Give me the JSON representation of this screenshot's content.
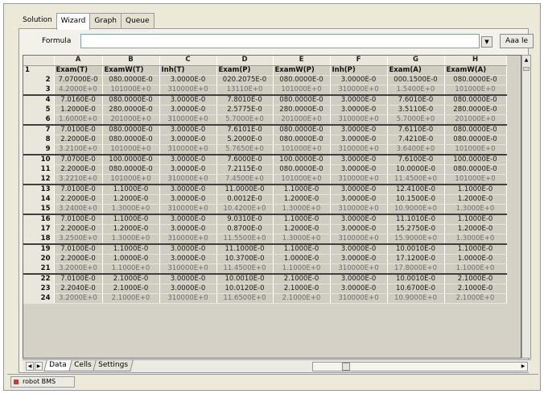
{
  "tabs": [
    {
      "label": "Solution",
      "active": false,
      "plain": true
    },
    {
      "label": "Wizard",
      "active": true
    },
    {
      "label": "Graph",
      "active": false
    },
    {
      "label": "Queue",
      "active": false
    }
  ],
  "formula": {
    "label": "Formula",
    "value": "",
    "apply_label": "Aaa le"
  },
  "columns": [
    "",
    "A",
    "B",
    "C",
    "D",
    "E",
    "F",
    "G",
    "H"
  ],
  "header_row": {
    "num": "1",
    "cells": [
      "Exam(T)",
      "ExamW(T)",
      "Inh(T)",
      "Exam(P)",
      "ExamW(P)",
      "Inh(P)",
      "Exam(A)",
      "ExamW(A)"
    ]
  },
  "rows": [
    {
      "num": "2",
      "cells": [
        "7.07000E-0",
        "080.0000E-0",
        "3.0000E-0",
        "020.2075E-0",
        "080.0000E-0",
        "3.0000E-0",
        "000.1500E-0",
        "080.0000E-0"
      ]
    },
    {
      "num": "3",
      "cells": [
        "4.2000E+0",
        "101000E+0",
        "310000E+0",
        "13110E+0",
        "101000E+0",
        "310000E+0",
        "1.5400E+0",
        "101000E+0"
      ]
    },
    {
      "num": "4",
      "cells": [
        "7.0160E-0",
        "080.0000E-0",
        "3.0000E-0",
        "7.8010E-0",
        "080.0000E-0",
        "3.0000E-0",
        "7.6010E-0",
        "080.0000E-0"
      ]
    },
    {
      "num": "5",
      "cells": [
        "1.2000E-0",
        "280.0000E-0",
        "3.0000E-0",
        "2.5775E-0",
        "280.0000E-0",
        "3.0000E-0",
        "3.5110E-0",
        "280.0000E-0"
      ]
    },
    {
      "num": "6",
      "cells": [
        "1.6000E+0",
        "201000E+0",
        "310000E+0",
        "5.7000E+0",
        "201000E+0",
        "310000E+0",
        "5.7000E+0",
        "201000E+0"
      ]
    },
    {
      "num": "7",
      "cells": [
        "7.0100E-0",
        "080.0000E-0",
        "3.0000E-0",
        "7.6101E-0",
        "080.0000E-0",
        "3.0000E-0",
        "7.6110E-0",
        "080.0000E-0"
      ]
    },
    {
      "num": "8",
      "cells": [
        "2.2000E-0",
        "080.0000E-0",
        "3.0000E-0",
        "5.2000E-0",
        "080.0000E-0",
        "3.0000E-0",
        "7.4210E-0",
        "080.0000E-0"
      ]
    },
    {
      "num": "9",
      "cells": [
        "3.2100E+0",
        "101000E+0",
        "310000E+0",
        "5.7650E+0",
        "101000E+0",
        "310000E+0",
        "3.6400E+0",
        "101000E+0"
      ]
    },
    {
      "num": "10",
      "cells": [
        "7.0700E-0",
        "100.0000E-0",
        "3.0000E-0",
        "7.6000E-0",
        "100.0000E-0",
        "3.0000E-0",
        "7.6100E-0",
        "100.0000E-0"
      ]
    },
    {
      "num": "11",
      "cells": [
        "2.2000E-0",
        "080.0000E-0",
        "3.0000E-0",
        "7.2115E-0",
        "080.0000E-0",
        "3.0000E-0",
        "10.0000E-0",
        "080.0000E-0"
      ]
    },
    {
      "num": "12",
      "cells": [
        "3.2210E+0",
        "101000E+0",
        "310000E+0",
        "7.4500E+0",
        "101000E+0",
        "310000E+0",
        "11.4500E+0",
        "101000E+0"
      ]
    },
    {
      "num": "13",
      "cells": [
        "7.0100E-0",
        "1.1000E-0",
        "3.0000E-0",
        "11.0000E-0",
        "1.1000E-0",
        "3.0000E-0",
        "12.4100E-0",
        "1.1000E-0"
      ]
    },
    {
      "num": "14",
      "cells": [
        "2.2000E-0",
        "1.2000E-0",
        "3.0000E-0",
        "0.0012E-0",
        "1.2000E-0",
        "3.0000E-0",
        "10.1500E-0",
        "1.2000E-0"
      ]
    },
    {
      "num": "15",
      "cells": [
        "3.2400E+0",
        "1.3000E+0",
        "310000E+0",
        "10.4200E+0",
        "1.3000E+0",
        "310000E+0",
        "10.9000E+0",
        "1.3000E+0"
      ]
    },
    {
      "num": "16",
      "cells": [
        "7.0100E-0",
        "1.1000E-0",
        "3.0000E-0",
        "9.0310E-0",
        "1.1000E-0",
        "3.0000E-0",
        "11.1010E-0",
        "1.1000E-0"
      ]
    },
    {
      "num": "17",
      "cells": [
        "2.2000E-0",
        "1.2000E-0",
        "3.0000E-0",
        "0.8700E-0",
        "1.2000E-0",
        "3.0000E-0",
        "15.2750E-0",
        "1.2000E-0"
      ]
    },
    {
      "num": "18",
      "cells": [
        "3.2500E+0",
        "1.3000E+0",
        "310000E+0",
        "11.5500E+0",
        "1.3000E+0",
        "310000E+0",
        "15.9000E+0",
        "1.3000E+0"
      ]
    },
    {
      "num": "19",
      "cells": [
        "7.0100E-0",
        "1.1000E-0",
        "3.0000E-0",
        "11.1000E-0",
        "1.1000E-0",
        "3.0000E-0",
        "10.0010E-0",
        "1.1000E-0"
      ]
    },
    {
      "num": "20",
      "cells": [
        "2.2000E-0",
        "1.0000E-0",
        "3.0000E-0",
        "10.3700E-0",
        "1.0000E-0",
        "3.0000E-0",
        "17.1200E-0",
        "1.0000E-0"
      ]
    },
    {
      "num": "21",
      "cells": [
        "3.2000E+0",
        "1.1000E+0",
        "310000E+0",
        "11.4500E+0",
        "1.1000E+0",
        "310000E+0",
        "17.8000E+0",
        "1.1000E+0"
      ]
    },
    {
      "num": "22",
      "cells": [
        "7.0100E-0",
        "2.1000E-0",
        "3.0000E-0",
        "10.0010E-0",
        "2.1000E-0",
        "3.0000E-0",
        "10.0010E-0",
        "2.1000E-0"
      ]
    },
    {
      "num": "23",
      "cells": [
        "2.2040E-0",
        "2.1000E-0",
        "3.0000E-0",
        "10.0120E-0",
        "2.1000E-0",
        "3.0000E-0",
        "10.6700E-0",
        "2.1000E-0"
      ]
    },
    {
      "num": "24",
      "cells": [
        "3.2000E+0",
        "2.1000E+0",
        "310000E+0",
        "11.6500E+0",
        "2.1000E+0",
        "310000E+0",
        "10.9000E+0",
        "2.1000E+0"
      ]
    }
  ],
  "sheet_tabs": [
    {
      "label": "Data",
      "active": true
    },
    {
      "label": "Cells",
      "active": false
    },
    {
      "label": "Settings",
      "active": false
    }
  ],
  "status": {
    "text": "robot BMS"
  }
}
